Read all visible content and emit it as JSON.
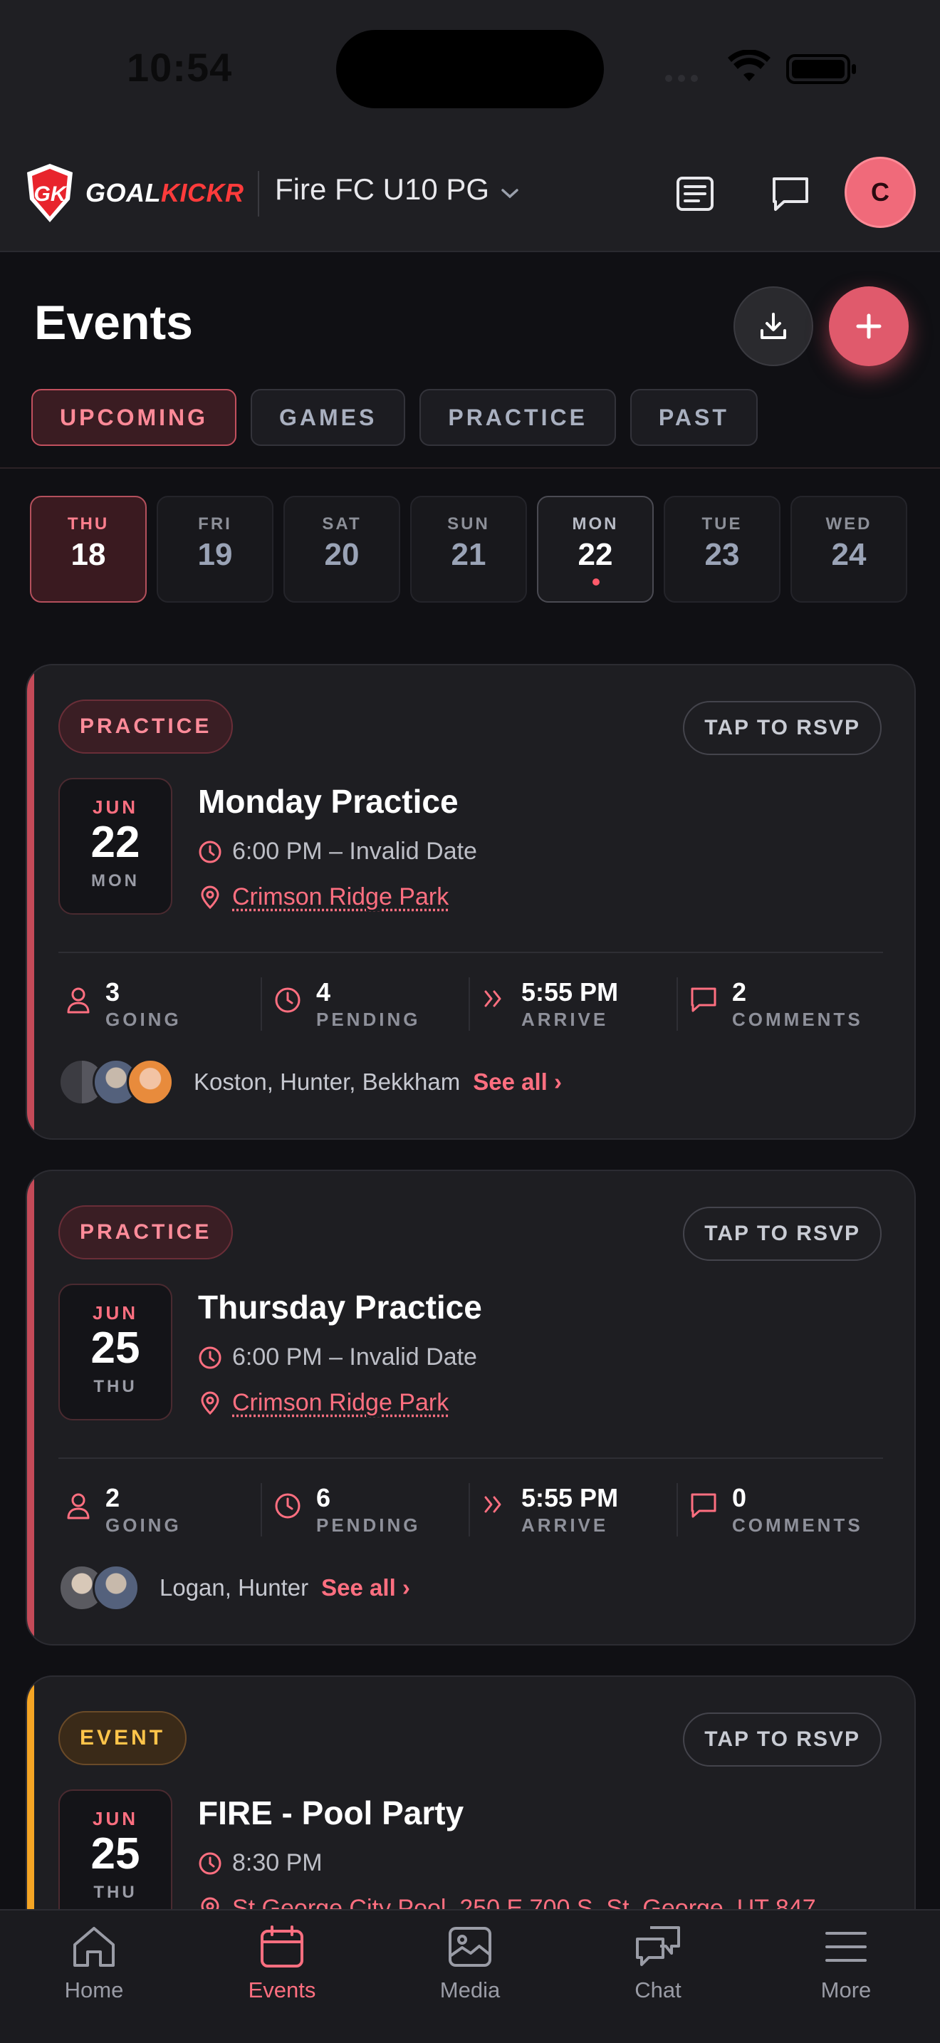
{
  "status_bar": {
    "time": "10:54"
  },
  "header": {
    "brand_1": "GOAL",
    "brand_2": "KICKR",
    "team": "Fire FC U10 PG",
    "avatar_initial": "C"
  },
  "page": {
    "title": "Events"
  },
  "tabs": [
    "UPCOMING",
    "GAMES",
    "PRACTICE",
    "PAST"
  ],
  "days": [
    {
      "dow": "THU",
      "num": "18"
    },
    {
      "dow": "FRI",
      "num": "19"
    },
    {
      "dow": "SAT",
      "num": "20"
    },
    {
      "dow": "SUN",
      "num": "21"
    },
    {
      "dow": "MON",
      "num": "22"
    },
    {
      "dow": "TUE",
      "num": "23"
    },
    {
      "dow": "WED",
      "num": "24"
    }
  ],
  "events": [
    {
      "type": "PRACTICE",
      "rsvp": "TAP TO RSVP",
      "month": "JUN",
      "day": "22",
      "weekday": "MON",
      "title": "Monday Practice",
      "time": "6:00 PM – Invalid Date",
      "location": "Crimson Ridge Park",
      "stats": {
        "going": "3",
        "going_label": "GOING",
        "pending": "4",
        "pending_label": "PENDING",
        "arrive": "5:55 PM",
        "arrive_label": "ARRIVE",
        "comments": "2",
        "comments_label": "COMMENTS"
      },
      "attendees": "Koston, Hunter, Bekkham",
      "see_all": "See all ›"
    },
    {
      "type": "PRACTICE",
      "rsvp": "TAP TO RSVP",
      "month": "JUN",
      "day": "25",
      "weekday": "THU",
      "title": "Thursday Practice",
      "time": "6:00 PM – Invalid Date",
      "location": "Crimson Ridge Park",
      "stats": {
        "going": "2",
        "going_label": "GOING",
        "pending": "6",
        "pending_label": "PENDING",
        "arrive": "5:55 PM",
        "arrive_label": "ARRIVE",
        "comments": "0",
        "comments_label": "COMMENTS"
      },
      "attendees": "Logan, Hunter",
      "see_all": "See all ›"
    },
    {
      "type": "EVENT",
      "rsvp": "TAP TO RSVP",
      "month": "JUN",
      "day": "25",
      "weekday": "THU",
      "title": "FIRE - Pool Party",
      "time": "8:30 PM",
      "location": "St George City Pool, 250 E 700 S, St. George, UT 847"
    }
  ],
  "nav": [
    {
      "label": "Home",
      "icon": "home-icon"
    },
    {
      "label": "Events",
      "icon": "calendar-icon"
    },
    {
      "label": "Media",
      "icon": "media-icon"
    },
    {
      "label": "Chat",
      "icon": "chat-icon"
    },
    {
      "label": "More",
      "icon": "menu-icon"
    }
  ],
  "colors": {
    "accent": "#ff6f80",
    "practice_bar": "#c44a58",
    "event_bar": "#f5a524"
  }
}
